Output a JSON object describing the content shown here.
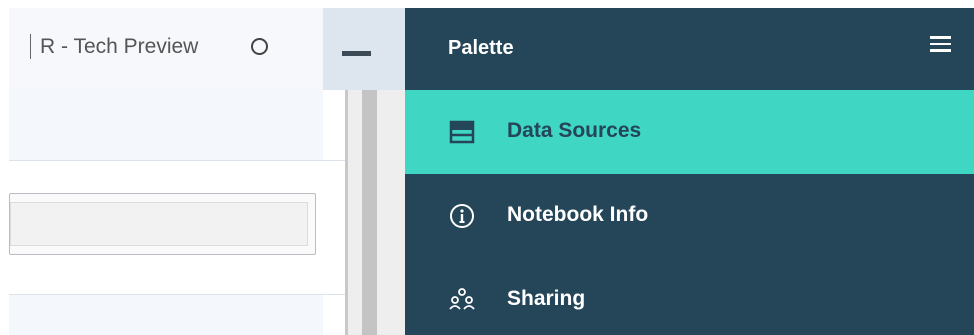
{
  "kernel": {
    "name": "R - Tech Preview",
    "status": "idle"
  },
  "palette": {
    "title": "Palette",
    "items": [
      {
        "label": "Data Sources",
        "icon": "data-sources-icon",
        "active": true
      },
      {
        "label": "Notebook Info",
        "icon": "info-icon",
        "active": false
      },
      {
        "label": "Sharing",
        "icon": "sharing-icon",
        "active": false
      }
    ]
  },
  "colors": {
    "palette_bg": "#254558",
    "active_item": "#3fd6c3"
  }
}
